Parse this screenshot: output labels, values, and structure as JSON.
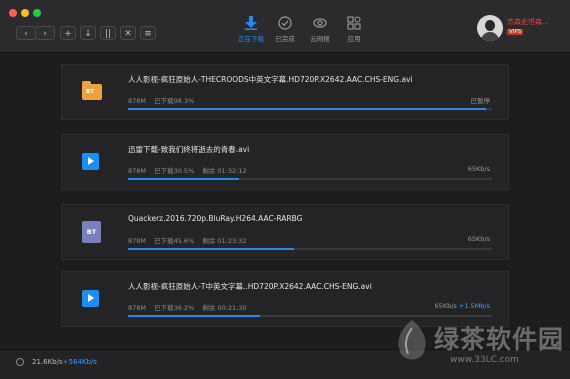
{
  "header": {
    "tabs": [
      {
        "label": "正在下载",
        "icon": "download-icon",
        "active": true
      },
      {
        "label": "已完成",
        "icon": "check-circle-icon",
        "active": false
      },
      {
        "label": "云网搜",
        "icon": "cloud-search-icon",
        "active": false
      },
      {
        "label": "应用",
        "icon": "apps-icon",
        "active": false
      }
    ],
    "user": {
      "name": "杰森史坦森...",
      "badge": "VIPS"
    },
    "toolbar": {
      "back": "‹",
      "forward": "›",
      "add": "+",
      "download": "↓",
      "pause": "||",
      "delete": "✕",
      "sort": "≡"
    }
  },
  "downloads": [
    {
      "name": "人人影视-疯狂原始人-THECROODS中英文字幕.HD720P.X2642.AAC.CHS-ENG.avi",
      "size": "878M",
      "progress_text": "已下载98.3%",
      "remaining": "",
      "status": "已暂停",
      "speed": "",
      "upload": "",
      "progress": 0.983,
      "icon": "bt-folder-icon",
      "icon_label": "BT"
    },
    {
      "name": "迅雷下载-致我们终将逝去的青春.avi",
      "size": "878M",
      "progress_text": "已下载30.5%",
      "remaining": "剩余 01:32:12",
      "status": "",
      "speed": "65Kb/s",
      "upload": "",
      "progress": 0.305,
      "icon": "video-play-icon",
      "icon_label": ""
    },
    {
      "name": "Quackerz.2016.720p.BluRay.H264.AAC-RARBG",
      "size": "878M",
      "progress_text": "已下载45.6%",
      "remaining": "剩余 01:23:32",
      "status": "",
      "speed": "65Kb/s",
      "upload": "",
      "progress": 0.456,
      "icon": "bt-file-icon",
      "icon_label": "BT"
    },
    {
      "name": "人人影视-疯狂原始人-T中英文字幕..HD720P.X2642.AAC.CHS-ENG.avi",
      "size": "878M",
      "progress_text": "已下载36.2%",
      "remaining": "剩余 00:21:30",
      "status": "",
      "speed": "65Kb/s",
      "upload": "+1.5Mb/s",
      "progress": 0.362,
      "icon": "video-play-icon",
      "icon_label": ""
    }
  ],
  "statusbar": {
    "down_speed": "21.6Kb/s",
    "up_speed": "+564Kb/s"
  },
  "watermark": {
    "text": "绿茶软件园",
    "url": "www.33LC.com"
  },
  "colors": {
    "accent": "#1e8cf0",
    "vip": "#c0392b",
    "username": "#e0463c",
    "folder": "#f0a03c",
    "bt_file": "#7a7fbd"
  }
}
